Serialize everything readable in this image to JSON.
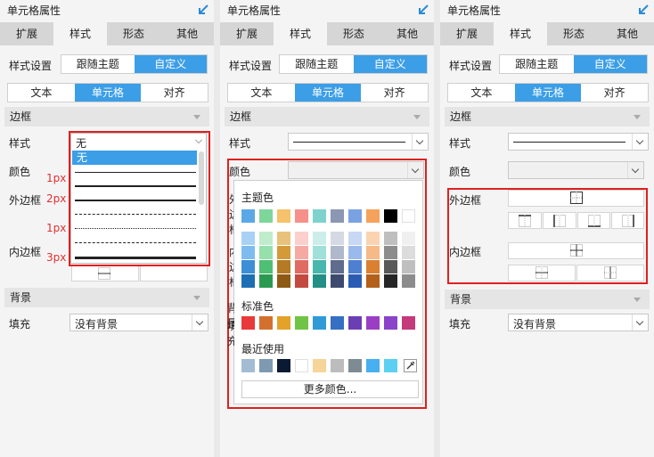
{
  "panel_title": "单元格属性",
  "tabs": [
    "扩展",
    "样式",
    "形态",
    "其他"
  ],
  "style_settings": {
    "label": "样式设置",
    "options": [
      "跟随主题",
      "自定义"
    ]
  },
  "subtabs": [
    "文本",
    "单元格",
    "对齐"
  ],
  "border_section": "边框",
  "style_label": "样式",
  "color_label": "颜色",
  "outer_border_label": "外边框",
  "inner_border_label": "内边框",
  "bg_section": "背景",
  "fill_label": "填充",
  "fill_value": "没有背景",
  "dropdown": {
    "none": "无",
    "annotations": [
      "1px",
      "2px",
      "1px",
      "3px"
    ]
  },
  "color_picker": {
    "theme_title": "主题色",
    "standard_title": "标准色",
    "recent_title": "最近使用",
    "more_colors": "更多颜色...",
    "theme_top": [
      "#5aa9e6",
      "#7ed69a",
      "#f6c26b",
      "#f5918a",
      "#7fd3cc",
      "#8c97b3",
      "#7aa2e3",
      "#f5a25d",
      "#000000",
      "#ffffff"
    ],
    "theme_shades": [
      [
        "#a9d1f5",
        "#bfeccb",
        "#e8c27a",
        "#fbd0cc",
        "#cbeeea",
        "#d5d9e3",
        "#c8d7f4",
        "#fbd3b0",
        "#bfbfbf",
        "#f0f0f0"
      ],
      [
        "#7ebcf0",
        "#95e0ab",
        "#d49a3a",
        "#f6a9a2",
        "#9fe0d9",
        "#b0b8cb",
        "#9ab9ec",
        "#f6b988",
        "#8c8c8c",
        "#dcdcdc"
      ],
      [
        "#3c8ed6",
        "#4fbf73",
        "#b57a25",
        "#e06b62",
        "#48b7ad",
        "#5f6c8e",
        "#4f7fd1",
        "#d98031",
        "#595959",
        "#bfbfbf"
      ],
      [
        "#1d6fb3",
        "#2a9a52",
        "#8d5a14",
        "#c44a40",
        "#238f86",
        "#3d4a6e",
        "#2a5cb3",
        "#b3601a",
        "#262626",
        "#8c8c8c"
      ]
    ],
    "standard": [
      "#e83a3a",
      "#d4702e",
      "#e5a228",
      "#70c445",
      "#2f9ad6",
      "#3570c4",
      "#6b3fb3",
      "#9a3fc4",
      "#8a43c9",
      "#c43a7a"
    ],
    "recent": [
      "#a3bcd4",
      "#7e9ab3",
      "#0a1a33",
      "#ffffff",
      "#f7d49a",
      "#bcbcbc",
      "#7e8b92",
      "#46b0f0",
      "#5bd0f2"
    ]
  }
}
